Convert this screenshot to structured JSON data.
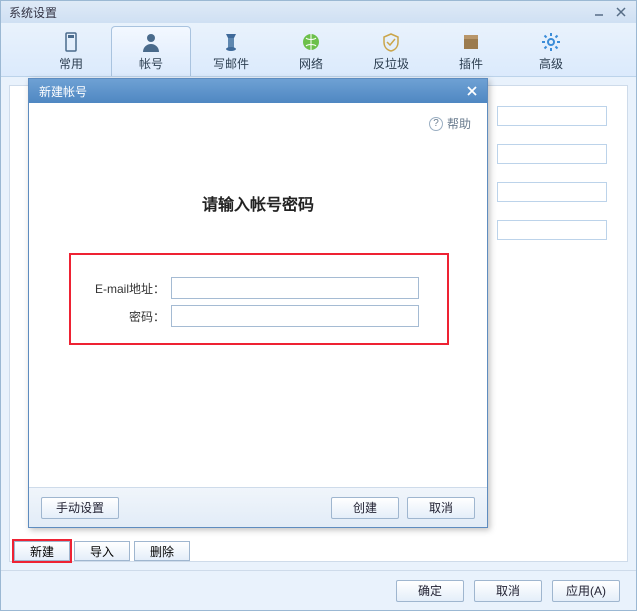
{
  "outer": {
    "title": "系统设置",
    "toolbar": [
      {
        "label": "常用",
        "name": "toolbar-common"
      },
      {
        "label": "帐号",
        "name": "toolbar-account",
        "selected": true
      },
      {
        "label": "写邮件",
        "name": "toolbar-compose"
      },
      {
        "label": "网络",
        "name": "toolbar-network"
      },
      {
        "label": "反垃圾",
        "name": "toolbar-antispam"
      },
      {
        "label": "插件",
        "name": "toolbar-plugins"
      },
      {
        "label": "高级",
        "name": "toolbar-advanced"
      }
    ],
    "mini_buttons": {
      "new": "新建",
      "import": "导入",
      "delete": "删除"
    },
    "bottom": {
      "ok": "确定",
      "cancel": "取消",
      "apply": "应用(A)"
    }
  },
  "dialog": {
    "title": "新建帐号",
    "help": "帮助",
    "heading": "请输入帐号密码",
    "fields": {
      "email_label": "E-mail地址：",
      "email_value": "",
      "password_label": "密码：",
      "password_value": ""
    },
    "footer": {
      "manual": "手动设置",
      "create": "创建",
      "cancel": "取消"
    }
  }
}
